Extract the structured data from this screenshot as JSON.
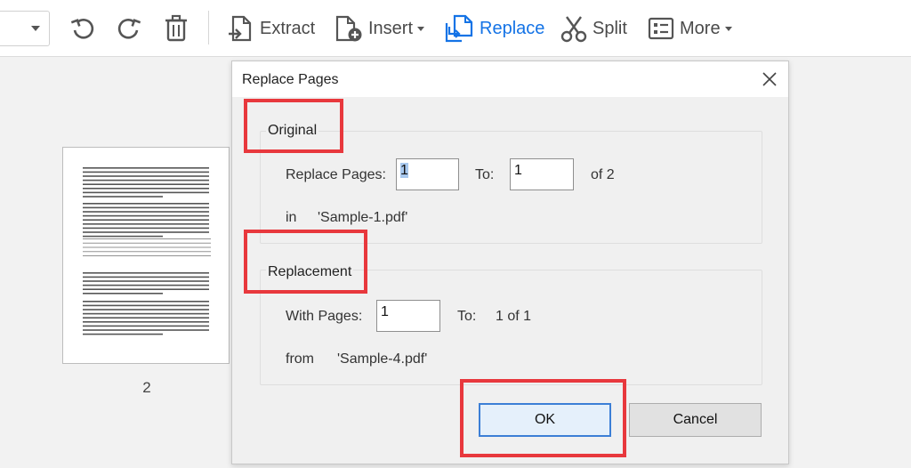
{
  "toolbar": {
    "extract_label": "Extract",
    "insert_label": "Insert",
    "replace_label": "Replace",
    "split_label": "Split",
    "more_label": "More",
    "icons": [
      "chevron-down-icon",
      "undo-icon",
      "redo-icon",
      "trash-icon",
      "extract-icon",
      "insert-icon",
      "replace-icon",
      "scissors-icon",
      "more-icon"
    ],
    "active_color": "#1473e6"
  },
  "thumbnail": {
    "page_number": "2"
  },
  "dialog": {
    "title": "Replace Pages",
    "original": {
      "group_label": "Original",
      "replace_pages_label": "Replace Pages:",
      "from_value": "1",
      "to_label": "To:",
      "to_value": "1",
      "of_text": "of 2",
      "in_label": "in",
      "file_name": "'Sample-1.pdf'"
    },
    "replacement": {
      "group_label": "Replacement",
      "with_pages_label": "With Pages:",
      "with_value": "1",
      "to_label": "To:",
      "to_text": "1 of 1",
      "from_label": "from",
      "file_name": "'Sample-4.pdf'"
    },
    "ok_label": "OK",
    "cancel_label": "Cancel"
  },
  "highlight_color": "#e8383d"
}
